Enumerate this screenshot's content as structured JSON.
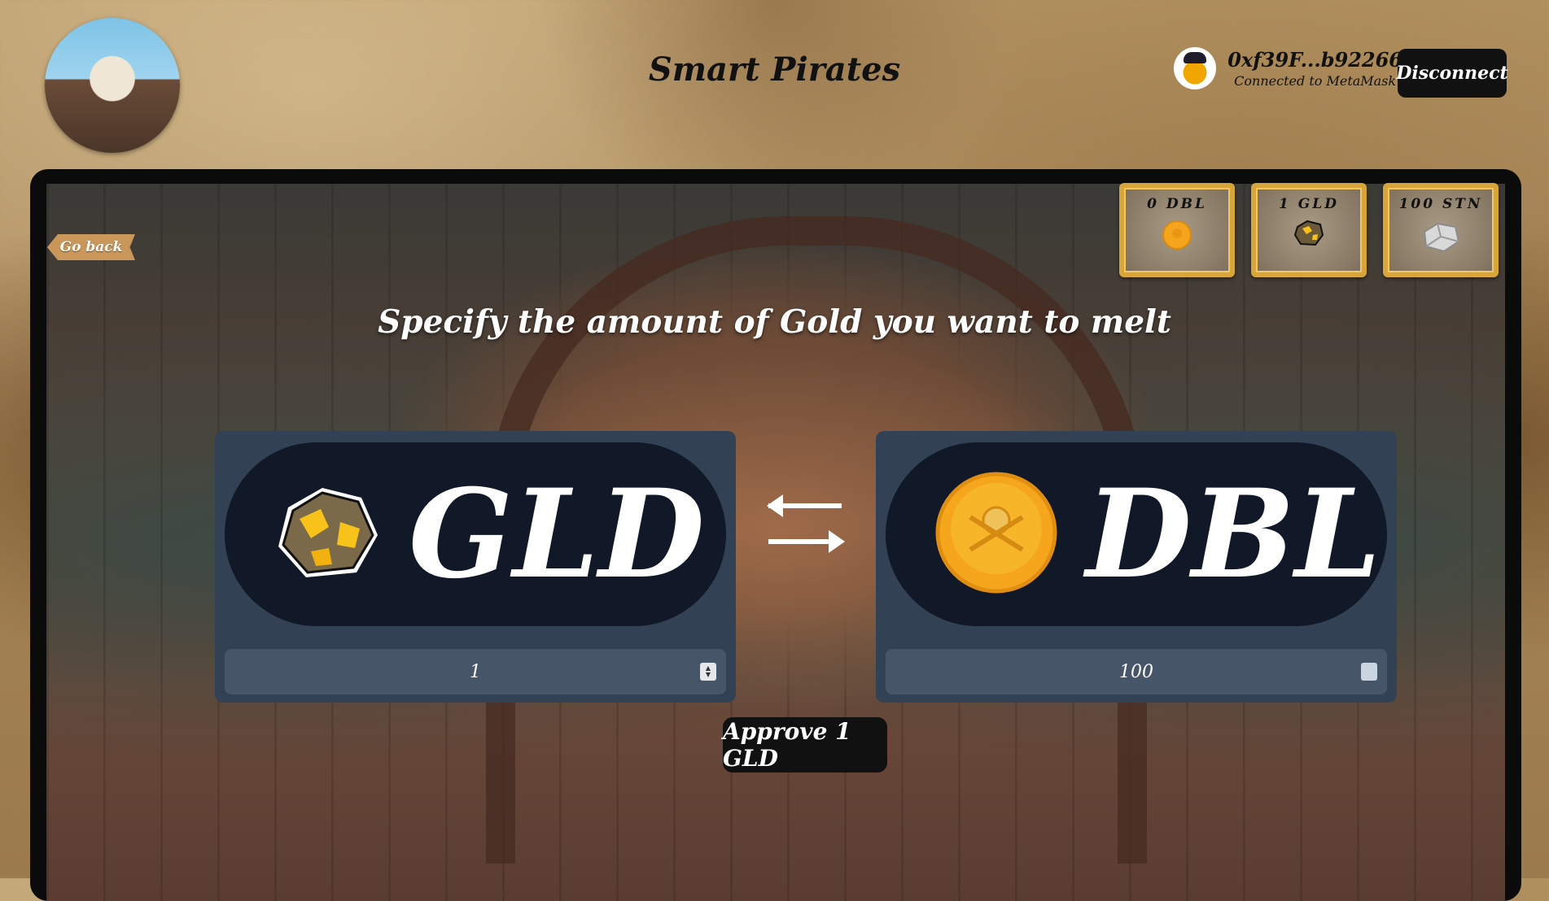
{
  "header": {
    "title": "Smart Pirates",
    "wallet_address": "0xf39F...b92266",
    "wallet_status": "Connected to MetaMask",
    "disconnect_label": "Disconnect"
  },
  "nav": {
    "go_back_label": "Go back"
  },
  "balances": [
    {
      "text": "0 DBL",
      "icon": "doubloon-coin-icon"
    },
    {
      "text": "1 GLD",
      "icon": "gold-nugget-icon"
    },
    {
      "text": "100 STN",
      "icon": "stone-icon"
    }
  ],
  "main": {
    "headline": "Specify the amount of Gold you want to melt",
    "from": {
      "token": "GLD",
      "icon": "gold-nugget-icon",
      "amount": "1"
    },
    "to": {
      "token": "DBL",
      "icon": "doubloon-coin-icon",
      "amount": "100"
    },
    "swap_icon": "swap-arrows-icon",
    "approve_label": "Approve 1 GLD"
  },
  "colors": {
    "card": "#334155",
    "pill": "#111827",
    "input": "#475569",
    "button": "#111111",
    "frame_gold": "#d8a53a"
  }
}
